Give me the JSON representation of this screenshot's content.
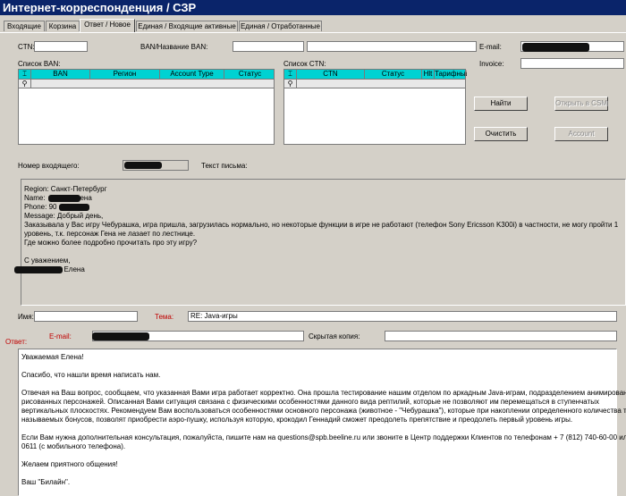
{
  "window": {
    "title": "Интернет-корреспонденция / СЗР"
  },
  "tabs": [
    {
      "label": "Входящие"
    },
    {
      "label": "Корзина"
    },
    {
      "label": "Ответ / Новое"
    },
    {
      "label": "Единая / Входящие активные"
    },
    {
      "label": "Единая / Отработанные"
    }
  ],
  "active_tab": 2,
  "search": {
    "ctn_label": "CTN:",
    "ctn_value": "",
    "ban_label": "BAN/Название BAN:",
    "ban_value": "",
    "ban_name_value": "",
    "email_label": "E-mail:",
    "email_value": "",
    "invoice_label": "Invoice:",
    "invoice_value": ""
  },
  "ban_list": {
    "label": "Список BAN:",
    "columns": [
      "BAN",
      "Регион",
      "Account Type",
      "Статус"
    ]
  },
  "ctn_list": {
    "label": "Список CTN:",
    "columns": [
      "CTN",
      "Статус",
      "Hlt",
      "Тарифный п"
    ]
  },
  "buttons": {
    "find": "Найти",
    "open_csm": "Открыть в CSM",
    "clear": "Очистить",
    "account": "Account"
  },
  "incoming": {
    "number_label": "Номер входящего:",
    "letter_label": "Текст письма:"
  },
  "letter": {
    "lines": [
      "Region: Санкт-Петербург",
      "Name:             Елена",
      "Phone: 90",
      "Message: Добрый день,",
      "Заказывала у Вас игру Чебурашка, игра пришла, загрузилась нормально, но некоторые функции в игре не работают (телефон Sony Ericsson K300i) в частности, не могу пройти 1",
      "уровень, т.к. персонаж Гена не лазает по лестнице.",
      "Где можно более подробно прочитать про эту игру?",
      "",
      "С уважением,",
      "                    Елена"
    ]
  },
  "reply_meta": {
    "name_label": "Имя:",
    "name_value": "",
    "subject_label": "Тема:",
    "subject_value": "RE: Java-игры",
    "answer_label": "Ответ:",
    "email_label": "E-mail:",
    "email_value": "",
    "hidden_copy_label": "Скрытая копия:",
    "hidden_copy_value": ""
  },
  "reply": {
    "lines": [
      "Уважаемая Елена!",
      "",
      "Спасибо, что нашли время написать нам.",
      "",
      "Отвечая на Ваш вопрос, сообщаем, что указанная Вами игра работает корректно. Она прошла тестирование нашим отделом по аркадным Java-играм, подразделением анимированных",
      "рисованных персонажей. Описанная Вами ситуация связана с физическими особенностями данного вида рептилий, которые не позволяют им перемещаться в ступенчатых",
      "вертикальных плоскостях. Рекомендуем Вам воспользоваться особенностями основного персонажа (животное - \"Чебурашка\"), которые при накоплении определенного количества так",
      "называемых бонусов, позволят приобрести аэро-пушку, используя которую, крокодил Геннадий сможет преодолеть препятствие и преодолеть первый уровень игры.",
      "",
      "Если Вам нужна дополнительная консультация, пожалуйста, пишите нам на questions@spb.beeline.ru или звоните в Центр поддержки Клиентов по телефонам + 7 (812) 740-60-00 или",
      "0611 (с мобильного телефона).",
      "",
      "Желаем приятного общения!",
      "",
      "Ваш \"Билайн\"."
    ]
  }
}
